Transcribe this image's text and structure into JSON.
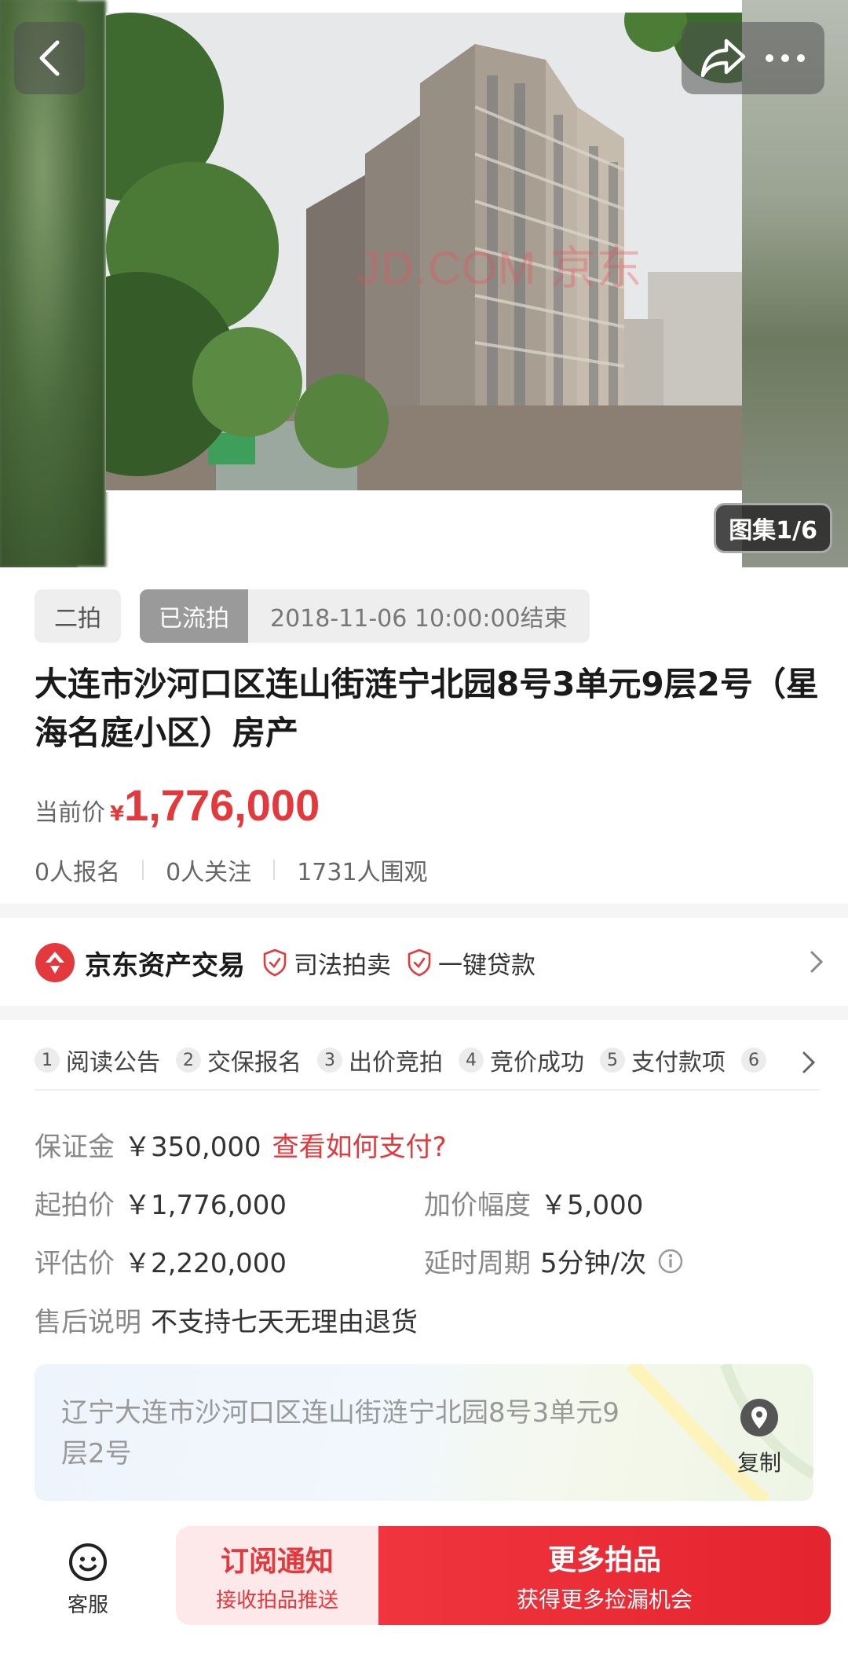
{
  "hero": {
    "watermark": "JD.COM 京东",
    "gallery_label": "图集1/6"
  },
  "auction": {
    "round": "二拍",
    "status": "已流拍",
    "end_time": "2018-11-06 10:00:00结束",
    "title": "大连市沙河口区连山街涟宁北园8号3单元9层2号（星海名庭小区）房产",
    "current_price_label": "当前价",
    "currency_symbol": "¥",
    "current_price": "1,776,000",
    "stats": {
      "signups": "0人报名",
      "followers": "0人关注",
      "viewers": "1731人围观"
    }
  },
  "store": {
    "name": "京东资产交易",
    "tags": [
      "司法拍卖",
      "一键贷款"
    ],
    "brand_color": "#e4393c"
  },
  "steps": [
    {
      "num": "1",
      "label": "阅读公告"
    },
    {
      "num": "2",
      "label": "交保报名"
    },
    {
      "num": "3",
      "label": "出价竞拍"
    },
    {
      "num": "4",
      "label": "竞价成功"
    },
    {
      "num": "5",
      "label": "支付款项"
    },
    {
      "num": "6",
      "label": ""
    }
  ],
  "details": {
    "deposit_label": "保证金",
    "deposit_value": "￥350,000",
    "deposit_link": "查看如何支付?",
    "start_price_label": "起拍价",
    "start_price_value": "￥1,776,000",
    "increment_label": "加价幅度",
    "increment_value": "￥5,000",
    "appraisal_label": "评估价",
    "appraisal_value": "￥2,220,000",
    "delay_label": "延时周期",
    "delay_value": "5分钟/次",
    "aftersale_label": "售后说明",
    "aftersale_value": "不支持七天无理由退货"
  },
  "address": {
    "text": "辽宁大连市沙河口区连山街涟宁北园8号3单元9层2号",
    "copy_label": "复制"
  },
  "bottom": {
    "service_label": "客服",
    "subscribe_main": "订阅通知",
    "subscribe_sub": "接收拍品推送",
    "more_main": "更多拍品",
    "more_sub": "获得更多捡漏机会"
  }
}
